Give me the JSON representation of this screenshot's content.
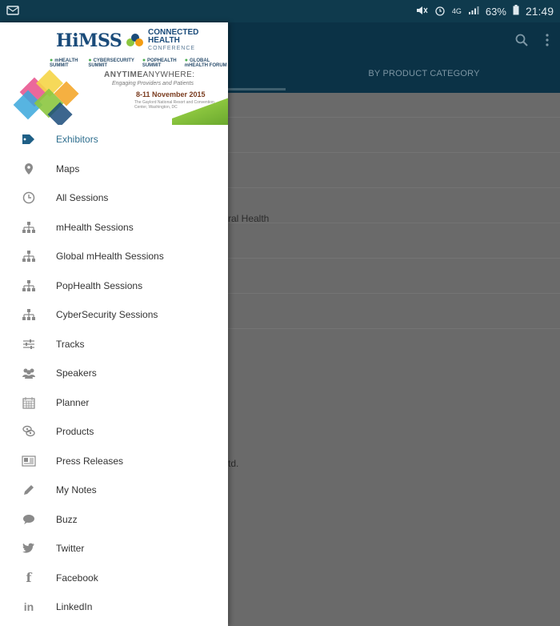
{
  "status_bar": {
    "mute_icon": "mute-icon",
    "alarm_icon": "alarm-icon",
    "network": "4G",
    "battery": "63%",
    "time": "21:49"
  },
  "app_bar": {
    "tab_label": "BY PRODUCT CATEGORY"
  },
  "background_content": {
    "text1": "ral Health",
    "text2": "td."
  },
  "banner": {
    "himss": "HiMSS",
    "connected_health": "CONNECTED HEALTH",
    "conference": "CONFERENCE",
    "summits": [
      "mHEALTH SUMMIT",
      "CYBERSECURITY SUMMIT",
      "POPHEALTH SUMMIT",
      "GLOBAL mHEALTH FORUM"
    ],
    "anytime": "ANYTIME",
    "anywhere": "ANYWHERE:",
    "engaging": "Engaging Providers and Patients",
    "dates": "8-11 November 2015",
    "venue": "The Gaylord National Resort and Convention Center, Washington, DC"
  },
  "menu": {
    "items": [
      {
        "label": "Exhibitors",
        "icon": "tag-icon",
        "active": true
      },
      {
        "label": "Maps",
        "icon": "map-pin-icon"
      },
      {
        "label": "All Sessions",
        "icon": "clock-icon"
      },
      {
        "label": "mHealth Sessions",
        "icon": "hierarchy-icon"
      },
      {
        "label": "Global mHealth Sessions",
        "icon": "hierarchy-icon"
      },
      {
        "label": "PopHealth Sessions",
        "icon": "hierarchy-icon"
      },
      {
        "label": "CyberSecurity Sessions",
        "icon": "hierarchy-icon"
      },
      {
        "label": "Tracks",
        "icon": "sliders-icon"
      },
      {
        "label": "Speakers",
        "icon": "people-icon"
      },
      {
        "label": "Planner",
        "icon": "calendar-icon"
      },
      {
        "label": "Products",
        "icon": "products-icon"
      },
      {
        "label": "Press Releases",
        "icon": "newspaper-icon"
      },
      {
        "label": "My Notes",
        "icon": "pencil-icon"
      },
      {
        "label": "Buzz",
        "icon": "chat-bubble-icon"
      },
      {
        "label": "Twitter",
        "icon": "twitter-icon"
      },
      {
        "label": "Facebook",
        "icon": "facebook-icon"
      },
      {
        "label": "LinkedIn",
        "icon": "linkedin-icon"
      }
    ]
  },
  "colors": {
    "status_bar": "#0f3a4d",
    "app_bar": "#0b3246",
    "scrim": "#6a6a6a",
    "active_text": "#2f6f8f"
  }
}
